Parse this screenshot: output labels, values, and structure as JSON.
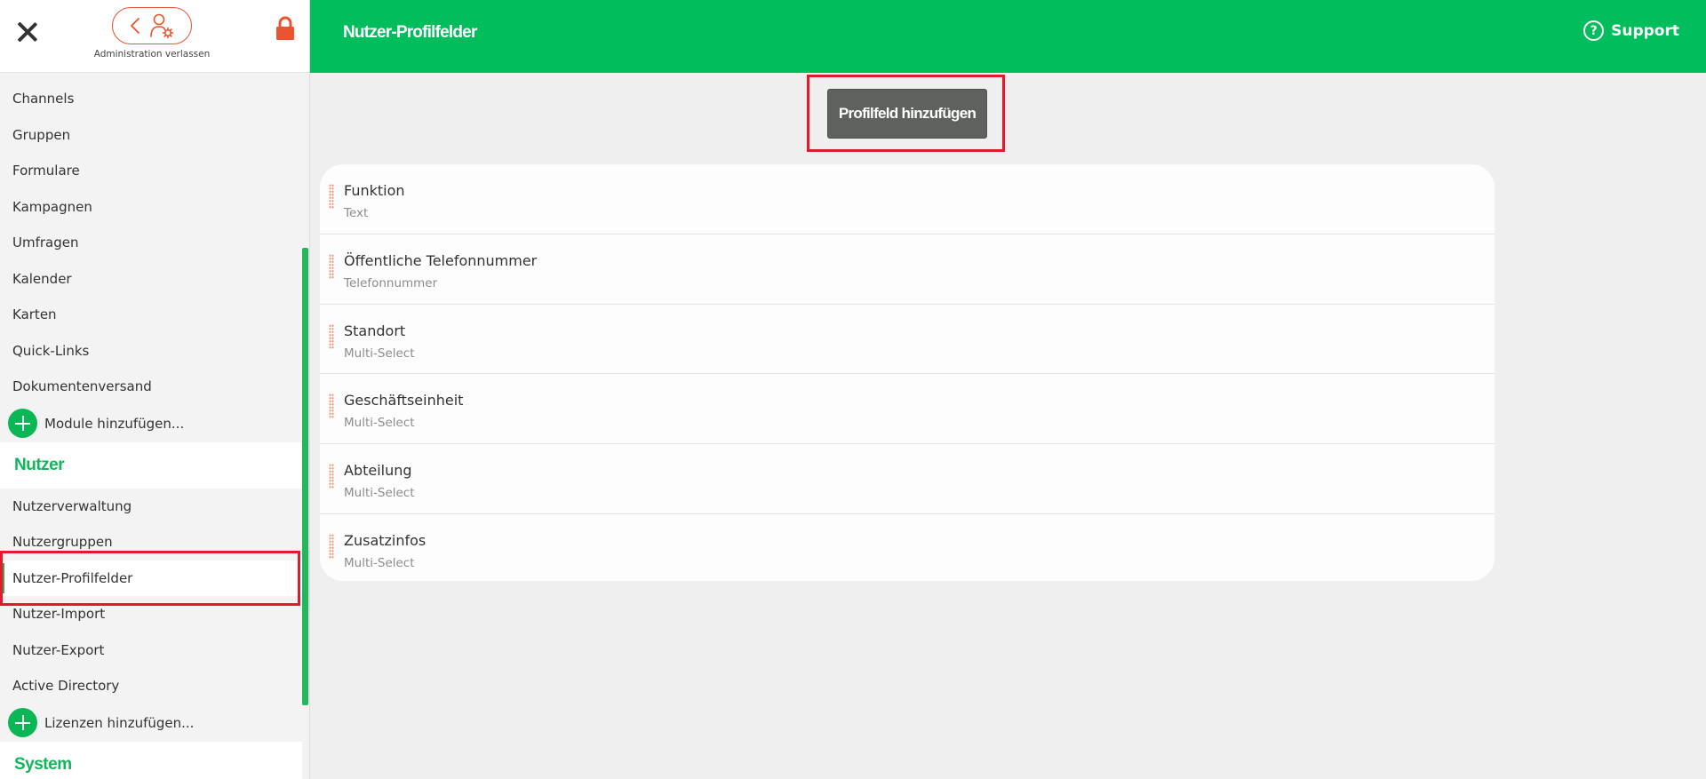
{
  "sidebar": {
    "admin_exit_label": "Administration verlassen",
    "modules": [
      {
        "label": "Channels"
      },
      {
        "label": "Gruppen"
      },
      {
        "label": "Formulare"
      },
      {
        "label": "Kampagnen"
      },
      {
        "label": "Umfragen"
      },
      {
        "label": "Kalender"
      },
      {
        "label": "Karten"
      },
      {
        "label": "Quick-Links"
      },
      {
        "label": "Dokumentenversand"
      }
    ],
    "add_modules_label": "Module hinzufügen...",
    "user_section_title": "Nutzer",
    "user_items": [
      {
        "label": "Nutzerverwaltung"
      },
      {
        "label": "Nutzergruppen"
      },
      {
        "label": "Nutzer-Profilfelder",
        "active": true
      },
      {
        "label": "Nutzer-Import"
      },
      {
        "label": "Nutzer-Export"
      },
      {
        "label": "Active Directory"
      }
    ],
    "add_licenses_label": "Lizenzen hinzufügen...",
    "system_section_title": "System"
  },
  "header": {
    "title": "Nutzer-Profilfelder",
    "support_label": "Support",
    "support_icon_glyph": "?"
  },
  "main": {
    "add_field_button": "Profilfeld hinzufügen",
    "fields": [
      {
        "name": "Funktion",
        "type": "Text"
      },
      {
        "name": "Öffentliche Telefonnummer",
        "type": "Telefonnummer"
      },
      {
        "name": "Standort",
        "type": "Multi-Select"
      },
      {
        "name": "Geschäftseinheit",
        "type": "Multi-Select"
      },
      {
        "name": "Abteilung",
        "type": "Multi-Select"
      },
      {
        "name": "Zusatzinfos",
        "type": "Multi-Select"
      }
    ]
  },
  "colors": {
    "brand_green": "#02bd5b",
    "accent_orange": "#e9552f",
    "highlight_red": "#e01b2c",
    "button_gray": "#5f615e"
  }
}
